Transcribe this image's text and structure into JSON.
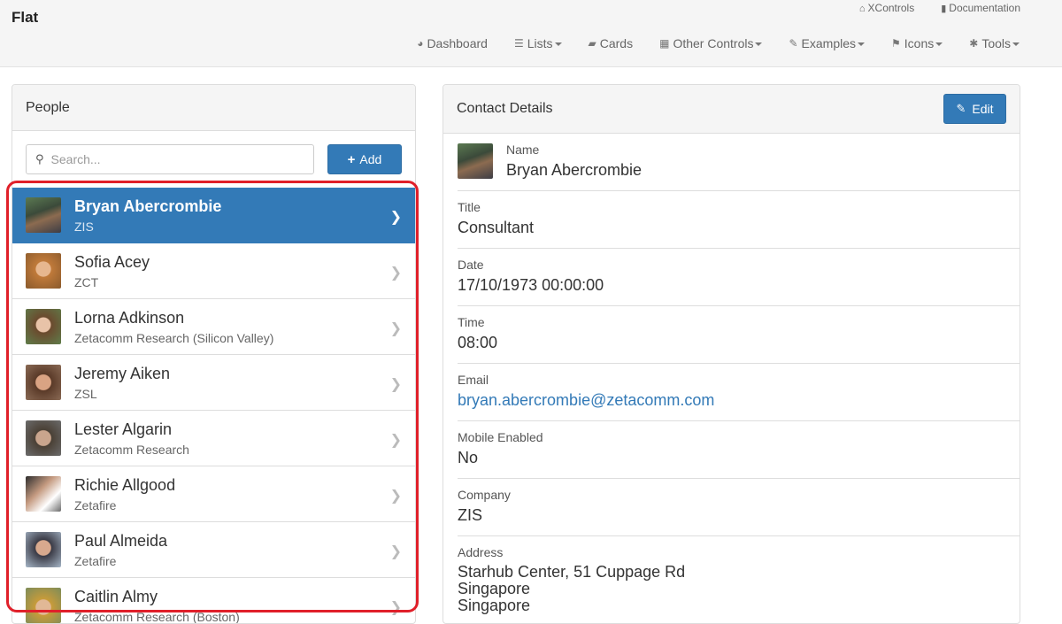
{
  "brand": "Flat",
  "top_links": [
    {
      "icon": "home-icon",
      "glyph": "⌂",
      "label": "XControls"
    },
    {
      "icon": "book-icon",
      "glyph": "▮",
      "label": "Documentation"
    }
  ],
  "nav": [
    {
      "icon": "dashboard-icon",
      "glyph": "◕",
      "label": "Dashboard",
      "dropdown": false
    },
    {
      "icon": "list-icon",
      "glyph": "☰",
      "label": "Lists",
      "dropdown": true
    },
    {
      "icon": "book-icon",
      "glyph": "▰",
      "label": "Cards",
      "dropdown": false
    },
    {
      "icon": "grid-icon",
      "glyph": "▦",
      "label": "Other Controls",
      "dropdown": true
    },
    {
      "icon": "edit-icon",
      "glyph": "✎",
      "label": "Examples",
      "dropdown": true
    },
    {
      "icon": "flag-icon",
      "glyph": "⚑",
      "label": "Icons",
      "dropdown": true
    },
    {
      "icon": "gear-icon",
      "glyph": "✱",
      "label": "Tools",
      "dropdown": true
    }
  ],
  "people": {
    "title": "People",
    "search_placeholder": "Search...",
    "add_label": "Add",
    "items": [
      {
        "name": "Bryan Abercrombie",
        "org": "ZIS",
        "active": true
      },
      {
        "name": "Sofia Acey",
        "org": "ZCT",
        "active": false
      },
      {
        "name": "Lorna Adkinson",
        "org": "Zetacomm Research (Silicon Valley)",
        "active": false
      },
      {
        "name": "Jeremy Aiken",
        "org": "ZSL",
        "active": false
      },
      {
        "name": "Lester Algarin",
        "org": "Zetacomm Research",
        "active": false
      },
      {
        "name": "Richie Allgood",
        "org": "Zetafire",
        "active": false
      },
      {
        "name": "Paul Almeida",
        "org": "Zetafire",
        "active": false
      },
      {
        "name": "Caitlin Almy",
        "org": "Zetacomm Research (Boston)",
        "active": false
      }
    ]
  },
  "details": {
    "title": "Contact Details",
    "edit_label": "Edit",
    "fields": {
      "name": {
        "label": "Name",
        "value": "Bryan Abercrombie"
      },
      "title": {
        "label": "Title",
        "value": "Consultant"
      },
      "date": {
        "label": "Date",
        "value": "17/10/1973 00:00:00"
      },
      "time": {
        "label": "Time",
        "value": "08:00"
      },
      "email": {
        "label": "Email",
        "value": "bryan.abercrombie@zetacomm.com"
      },
      "mobile": {
        "label": "Mobile Enabled",
        "value": "No"
      },
      "company": {
        "label": "Company",
        "value": "ZIS"
      },
      "address": {
        "label": "Address",
        "line1": "Starhub Center, 51 Cuppage Rd",
        "line2": "Singapore",
        "line3": "Singapore"
      }
    }
  },
  "colors": {
    "primary": "#337ab7",
    "highlight": "#e0202a"
  }
}
